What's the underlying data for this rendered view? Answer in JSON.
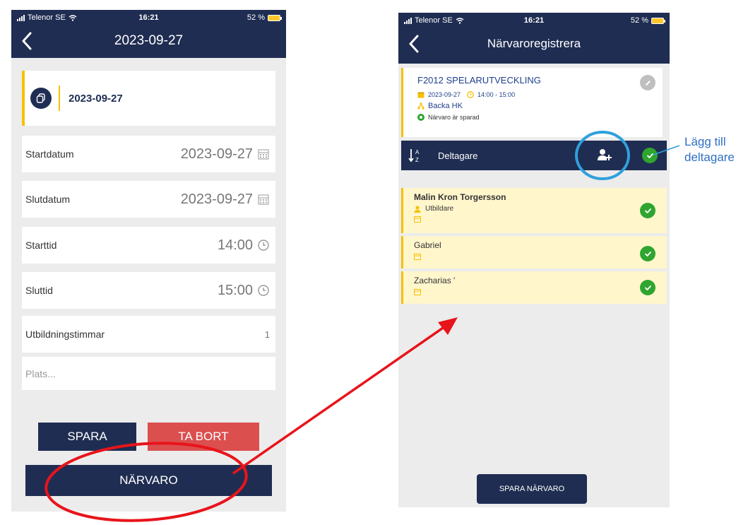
{
  "left_screen": {
    "status": {
      "carrier": "Telenor SE",
      "time": "16:21",
      "battery": "52 %"
    },
    "title": "2023-09-27",
    "date_card": {
      "date": "2023-09-27"
    },
    "fields": [
      {
        "label": "Startdatum",
        "value": "2023-09-27"
      },
      {
        "label": "Slutdatum",
        "value": "2023-09-27"
      },
      {
        "label": "Starttid",
        "value": "14:00"
      },
      {
        "label": "Sluttid",
        "value": "15:00"
      },
      {
        "label": "Utbildningstimmar",
        "value": "1"
      }
    ],
    "place_placeholder": "Plats...",
    "buttons": {
      "save": "SPARA",
      "delete": "TA BORT",
      "attendance": "NÄRVARO"
    }
  },
  "right_screen": {
    "status": {
      "carrier": "Telenor SE",
      "time": "16:21",
      "battery": "52 %"
    },
    "title": "Närvaroregistrera",
    "event": {
      "title": "F2012 SPELARUTVECKLING",
      "date": "2023-09-27",
      "time": "14:00 - 15:00",
      "club": "Backa HK",
      "status": "Närvaro är sparad"
    },
    "participants_label": "Deltagare",
    "participants": [
      {
        "name": "Malin Kron Torgersson",
        "role": "Utbildare"
      },
      {
        "name": "Gabriel",
        "role": ""
      },
      {
        "name": "Zacharias '",
        "role": ""
      }
    ],
    "save_button": "SPARA NÄRVARO"
  },
  "annotation": {
    "line1": "Lägg till",
    "line2": "deltagare"
  },
  "colors": {
    "navy": "#1f2d52",
    "accent_yellow": "#f5c100",
    "danger": "#db4f4f",
    "success": "#2fa52f",
    "annotation_red": "#e8141b",
    "annotation_blue": "#2fa0dc"
  }
}
